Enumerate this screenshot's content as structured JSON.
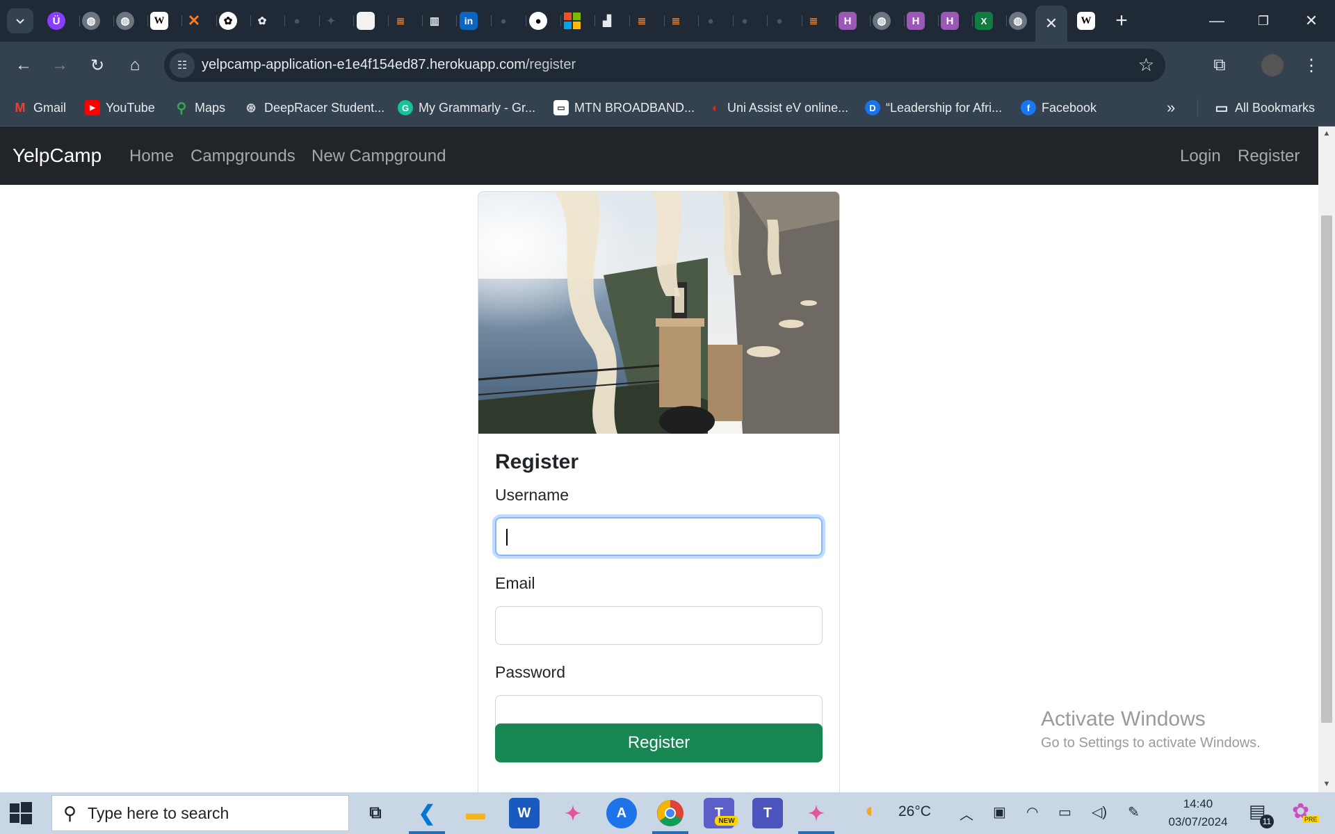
{
  "browser": {
    "active_tab_close_icon": "close-icon",
    "new_tab_label": "+",
    "address": {
      "host": "yelpcamp-application-e1e4f154ed87.herokuapp.com",
      "path": "/register"
    },
    "bookmarks": [
      {
        "label": "Gmail",
        "icon": "gmail-icon",
        "color": "#ea4335"
      },
      {
        "label": "YouTube",
        "icon": "youtube-icon",
        "color": "#ff0000"
      },
      {
        "label": "Maps",
        "icon": "maps-icon",
        "color": "#34a853"
      },
      {
        "label": "DeepRacer Student...",
        "icon": "deepracer-icon",
        "color": "#8a8f98"
      },
      {
        "label": "My Grammarly - Gr...",
        "icon": "grammarly-icon",
        "color": "#15c39a"
      },
      {
        "label": "MTN BROADBAND...",
        "icon": "mtn-icon",
        "color": "#ffffff"
      },
      {
        "label": "Uni Assist eV online...",
        "icon": "uniassist-icon",
        "color": "#d52b1e"
      },
      {
        "label": "“Leadership for Afri...",
        "icon": "d-letter-icon",
        "color": "#1a73e8"
      },
      {
        "label": "Facebook",
        "icon": "facebook-icon",
        "color": "#1877f2"
      }
    ],
    "all_bookmarks_label": "All Bookmarks"
  },
  "page": {
    "brand": "YelpCamp",
    "nav": {
      "home": "Home",
      "campgrounds": "Campgrounds",
      "new_campground": "New Campground",
      "login": "Login",
      "register": "Register"
    },
    "card": {
      "title": "Register",
      "username_label": "Username",
      "username_value": "",
      "email_label": "Email",
      "email_value": "",
      "password_label": "Password",
      "password_value": "",
      "submit_label": "Register"
    },
    "watermark": {
      "title": "Activate Windows",
      "subtitle": "Go to Settings to activate Windows."
    }
  },
  "taskbar": {
    "search_placeholder": "Type here to search",
    "weather": "26°C",
    "time": "14:40",
    "date": "03/07/2024",
    "notification_count": "11",
    "teams_badge": "NEW",
    "copilot_badge": "PRE"
  },
  "colors": {
    "navbar": "#212529",
    "register_button": "#198754",
    "focus_ring": "#86b7fe"
  }
}
